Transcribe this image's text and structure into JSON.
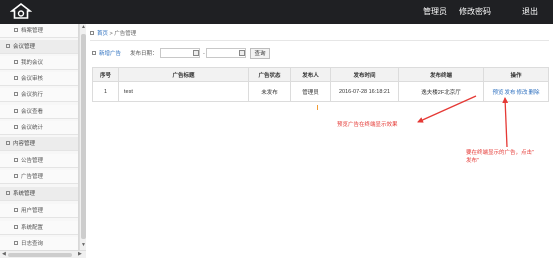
{
  "header": {
    "nav": [
      "管理员",
      "修改密码",
      "退出"
    ]
  },
  "sidebar": {
    "entries": [
      {
        "type": "item",
        "label": "档案管理"
      },
      {
        "type": "group",
        "label": "会议管理"
      },
      {
        "type": "item",
        "label": "我的会议"
      },
      {
        "type": "item",
        "label": "会议审核"
      },
      {
        "type": "item",
        "label": "会议执行"
      },
      {
        "type": "item",
        "label": "会议查看"
      },
      {
        "type": "item",
        "label": "会议统计"
      },
      {
        "type": "group",
        "label": "内容管理"
      },
      {
        "type": "item",
        "label": "公告管理"
      },
      {
        "type": "item",
        "label": "广告管理"
      },
      {
        "type": "group",
        "label": "系统管理"
      },
      {
        "type": "item",
        "label": "用户管理"
      },
      {
        "type": "item",
        "label": "系统配置"
      },
      {
        "type": "item",
        "label": "日志查询"
      }
    ]
  },
  "breadcrumb": {
    "home": "首页",
    "separator": ">",
    "current": "广告管理"
  },
  "toolbar": {
    "add_label": "新增广告",
    "date_label": "发布日期：",
    "date_from": "",
    "date_to": "",
    "separator": "-",
    "search_label": "查询"
  },
  "table": {
    "columns": [
      "序号",
      "广告标题",
      "广告状态",
      "发布人",
      "发布时间",
      "发布终端",
      "操作"
    ],
    "rows": [
      {
        "index": "1",
        "title": "test",
        "status": "未发布",
        "publisher": "管理员",
        "time": "2016-07-28 16:18:21",
        "terminal": "逸夫楼2F北京厅",
        "actions": [
          "预览",
          "发布",
          "修改",
          "删除"
        ]
      }
    ]
  },
  "annotations": {
    "preview_note": "预览广告在终端显示效果",
    "publish_note_line1": "要在终端显示的广告，点击\"",
    "publish_note_line2": "发布\""
  },
  "colors": {
    "topbar": "#1f2023",
    "link": "#2c6fbf",
    "annotation": "#e53935",
    "accent_orange": "#f39c33"
  }
}
